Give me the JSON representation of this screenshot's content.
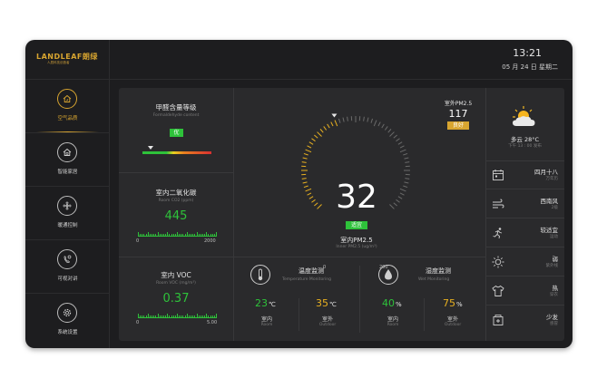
{
  "brand": {
    "logo_text": "LANDLEAF朗绿",
    "logo_sub": "人居科技创造者"
  },
  "header": {
    "time": "13:21",
    "date": "05 月 24 日  星期二"
  },
  "sidebar": {
    "items": [
      {
        "label": "空气品质",
        "icon": "home-leaf-icon",
        "active": true
      },
      {
        "label": "智能家居",
        "icon": "smart-home-icon",
        "active": false
      },
      {
        "label": "暖通控制",
        "icon": "fan-icon",
        "active": false
      },
      {
        "label": "可视对讲",
        "icon": "intercom-icon",
        "active": false
      },
      {
        "label": "系统设置",
        "icon": "gear-icon",
        "active": false
      }
    ]
  },
  "formaldehyde": {
    "title": "甲醛含量等级",
    "subtitle": "Formaldehyde content",
    "level": "优",
    "level_color": "#2ec23a",
    "level_position": 0.12
  },
  "co2": {
    "title": "室内二氧化碳",
    "subtitle": "Room CO2  (ppm)",
    "value": "445",
    "min": "0",
    "max": "2000"
  },
  "voc": {
    "title": "室内 VOC",
    "subtitle": "Room VOC  (mg/m³)",
    "value": "0.37",
    "min": "0",
    "max": "5.00"
  },
  "pm25": {
    "value": "32",
    "status": "适宜",
    "label": "室内PM2.5",
    "sublabel": "Inner PM2.5  (ug/m³)",
    "scale_min": "0",
    "scale_max": "200",
    "outdoor_label": "室外PM2.5",
    "outdoor_value": "117",
    "outdoor_status": "良好",
    "outdoor_status_color": "#d8a530"
  },
  "temperature": {
    "title": "温度监测",
    "subtitle": "Temperature Monitoring",
    "indoor_value": "23",
    "outdoor_value": "35",
    "unit": "℃",
    "indoor_label": "室内",
    "indoor_sub": "Room",
    "outdoor_label": "室外",
    "outdoor_sub": "Outdoor"
  },
  "humidity": {
    "title": "湿度监测",
    "subtitle": "Wet Monitoring",
    "indoor_value": "40",
    "outdoor_value": "75",
    "unit": "%",
    "indoor_label": "室内",
    "indoor_sub": "Room",
    "outdoor_label": "室外",
    "outdoor_sub": "Outdoor"
  },
  "weather": {
    "icon": "partly-cloudy-sun-icon",
    "condition": "多云 28°C",
    "update": "下午 13 : 00 发布",
    "rows": [
      {
        "icon": "calendar-icon",
        "value": "四月十八",
        "sub": "万年历"
      },
      {
        "icon": "wind-icon",
        "value": "西南风",
        "sub": "2级"
      },
      {
        "icon": "running-icon",
        "value": "较适宜",
        "sub": "运动"
      },
      {
        "icon": "sun-icon",
        "value": "弱",
        "sub": "紫外线"
      },
      {
        "icon": "shirt-icon",
        "value": "热",
        "sub": "穿衣"
      },
      {
        "icon": "medicine-icon",
        "value": "少发",
        "sub": "感冒"
      }
    ]
  },
  "colors": {
    "accent": "#d8a530",
    "good": "#2ec23a",
    "warn": "#e8b020",
    "bg": "#1d1d1f",
    "panel": "#2a2a2c"
  }
}
